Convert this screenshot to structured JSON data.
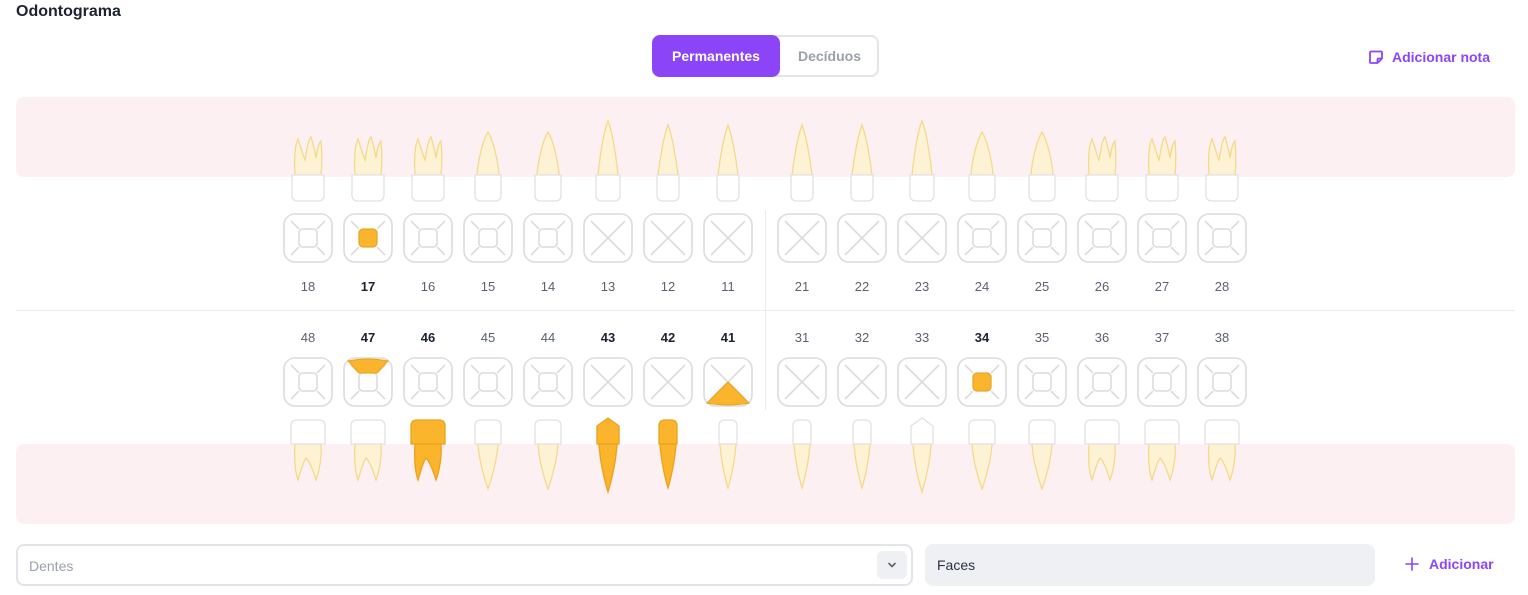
{
  "header": {
    "title": "Odontograma"
  },
  "tabs": [
    {
      "label": "Permanentes",
      "active": true
    },
    {
      "label": "Decíduos",
      "active": false
    }
  ],
  "note_button": {
    "label": "Adicionar nota",
    "icon": "note-icon"
  },
  "colors": {
    "accent": "#8b45f6",
    "marked": "#fbb52d",
    "tooth_fill": "#fdf3d4",
    "tooth_stroke": "#f5d98b",
    "band": "#fdf0f2"
  },
  "upper_teeth": [
    {
      "num": "18",
      "type": "molar",
      "center": "square",
      "marked": false,
      "face": null
    },
    {
      "num": "17",
      "type": "molar",
      "center": "square",
      "marked": true,
      "face": "center"
    },
    {
      "num": "16",
      "type": "molar",
      "center": "square",
      "marked": false,
      "face": null
    },
    {
      "num": "15",
      "type": "premolar",
      "center": "square",
      "marked": false,
      "face": null
    },
    {
      "num": "14",
      "type": "premolar",
      "center": "square",
      "marked": false,
      "face": null
    },
    {
      "num": "13",
      "type": "canine",
      "center": "x",
      "marked": false,
      "face": null
    },
    {
      "num": "12",
      "type": "incisor",
      "center": "x",
      "marked": false,
      "face": null
    },
    {
      "num": "11",
      "type": "incisor",
      "center": "x",
      "marked": false,
      "face": null
    },
    {
      "num": "21",
      "type": "incisor",
      "center": "x",
      "marked": false,
      "face": null
    },
    {
      "num": "22",
      "type": "incisor",
      "center": "x",
      "marked": false,
      "face": null
    },
    {
      "num": "23",
      "type": "canine",
      "center": "x",
      "marked": false,
      "face": null
    },
    {
      "num": "24",
      "type": "premolar",
      "center": "square",
      "marked": false,
      "face": null
    },
    {
      "num": "25",
      "type": "premolar",
      "center": "square",
      "marked": false,
      "face": null
    },
    {
      "num": "26",
      "type": "molar",
      "center": "square",
      "marked": false,
      "face": null
    },
    {
      "num": "27",
      "type": "molar",
      "center": "square",
      "marked": false,
      "face": null
    },
    {
      "num": "28",
      "type": "molar",
      "center": "square",
      "marked": false,
      "face": null
    }
  ],
  "lower_teeth": [
    {
      "num": "48",
      "type": "molar",
      "center": "square",
      "marked": false,
      "face": null,
      "root_marked": false
    },
    {
      "num": "47",
      "type": "molar",
      "center": "square",
      "marked": true,
      "face": "top",
      "root_marked": false
    },
    {
      "num": "46",
      "type": "molar",
      "center": "square",
      "marked": true,
      "face": null,
      "root_marked": true
    },
    {
      "num": "45",
      "type": "premolar",
      "center": "square",
      "marked": false,
      "face": null,
      "root_marked": false
    },
    {
      "num": "44",
      "type": "premolar",
      "center": "square",
      "marked": false,
      "face": null,
      "root_marked": false
    },
    {
      "num": "43",
      "type": "canine",
      "center": "x",
      "marked": true,
      "face": null,
      "root_marked": true
    },
    {
      "num": "42",
      "type": "incisor",
      "center": "x",
      "marked": true,
      "face": null,
      "root_marked": true
    },
    {
      "num": "41",
      "type": "incisor",
      "center": "x",
      "marked": true,
      "face": "bottom",
      "root_marked": false
    },
    {
      "num": "31",
      "type": "incisor",
      "center": "x",
      "marked": false,
      "face": null,
      "root_marked": false
    },
    {
      "num": "32",
      "type": "incisor",
      "center": "x",
      "marked": false,
      "face": null,
      "root_marked": false
    },
    {
      "num": "33",
      "type": "canine",
      "center": "x",
      "marked": false,
      "face": null,
      "root_marked": false
    },
    {
      "num": "34",
      "type": "premolar",
      "center": "square",
      "marked": true,
      "face": "center",
      "root_marked": false
    },
    {
      "num": "35",
      "type": "premolar",
      "center": "square",
      "marked": false,
      "face": null,
      "root_marked": false
    },
    {
      "num": "36",
      "type": "molar",
      "center": "square",
      "marked": false,
      "face": null,
      "root_marked": false
    },
    {
      "num": "37",
      "type": "molar",
      "center": "square",
      "marked": false,
      "face": null,
      "root_marked": false
    },
    {
      "num": "38",
      "type": "molar",
      "center": "square",
      "marked": false,
      "face": null,
      "root_marked": false
    }
  ],
  "form": {
    "teeth_placeholder": "Dentes",
    "faces_label": "Faces",
    "add_label": "Adicionar",
    "add_icon": "plus-icon",
    "caret_icon": "chevron-down-icon"
  }
}
